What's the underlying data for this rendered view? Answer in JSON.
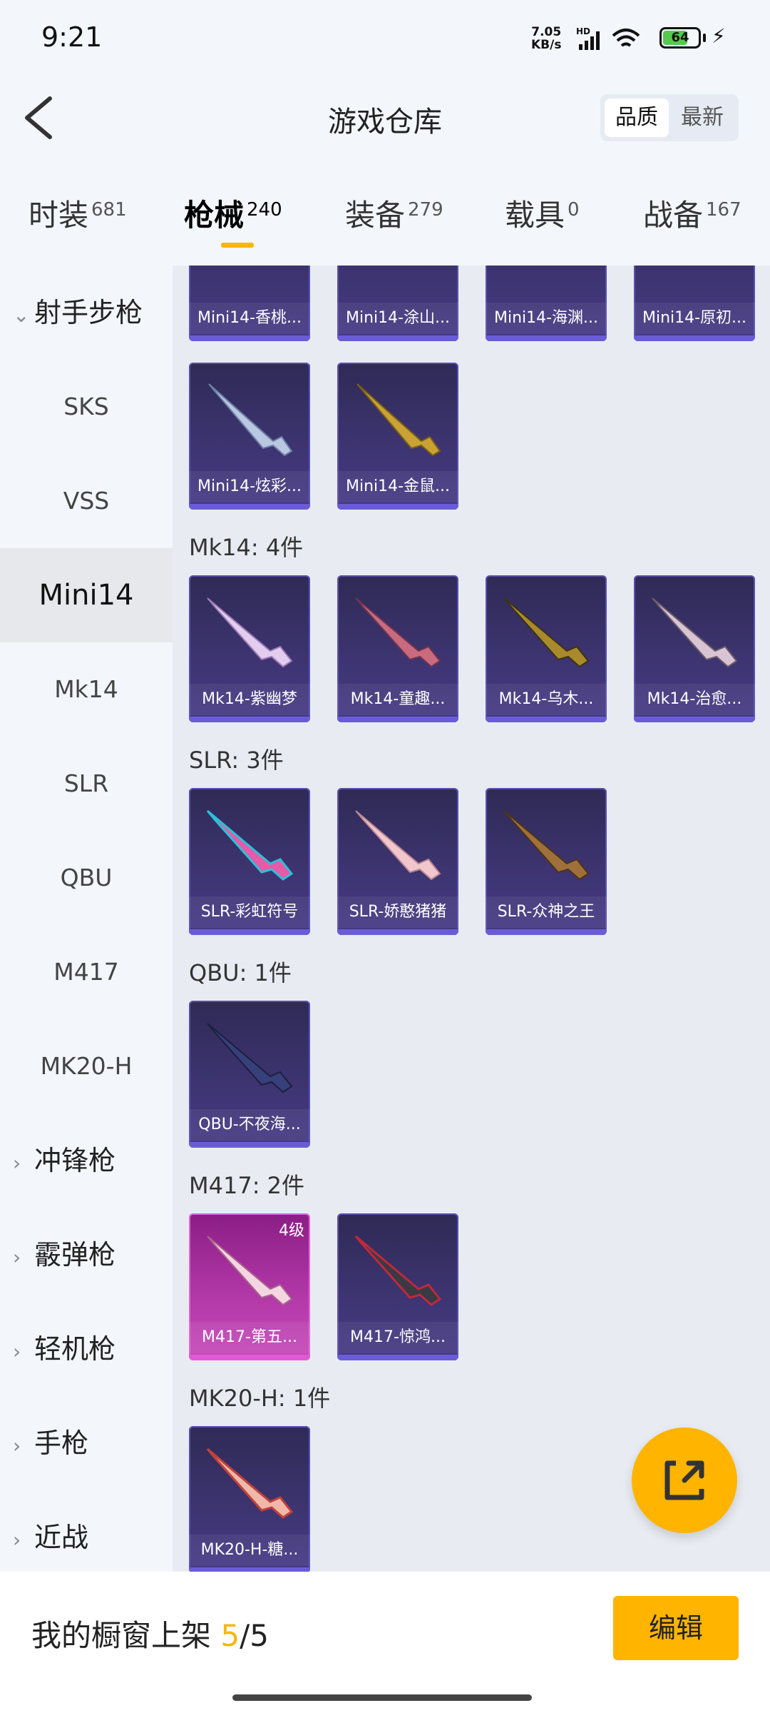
{
  "status_bar": {
    "time": "9:21",
    "net_speed_value": "7.05",
    "net_speed_unit": "KB/s",
    "hd_label": "HD",
    "battery": "64"
  },
  "header": {
    "title": "游戏仓库",
    "sort_options": [
      "品质",
      "最新"
    ],
    "sort_active": "品质"
  },
  "tabs": [
    {
      "label": "时装",
      "count": "681"
    },
    {
      "label": "枪械",
      "count": "240",
      "active": true
    },
    {
      "label": "装备",
      "count": "279"
    },
    {
      "label": "载具",
      "count": "0"
    },
    {
      "label": "战备",
      "count": "167"
    }
  ],
  "sidebar": {
    "group_expanded": "射手步枪",
    "items": [
      "SKS",
      "VSS",
      "Mini14",
      "Mk14",
      "SLR",
      "QBU",
      "M417",
      "MK20-H"
    ],
    "active_item": "Mini14",
    "groups_collapsed": [
      "冲锋枪",
      "霰弹枪",
      "轻机枪",
      "手枪",
      "近战"
    ]
  },
  "content": {
    "partial_row": [
      "Mini14-香桃...",
      "Mini14-涂山...",
      "Mini14-海渊...",
      "Mini14-原初..."
    ],
    "mini14_row2": [
      "Mini14-炫彩...",
      "Mini14-金鼠..."
    ],
    "sections": [
      {
        "label": "Mk14: 4件",
        "items": [
          "Mk14-紫幽梦",
          "Mk14-童趣...",
          "Mk14-乌木...",
          "Mk14-治愈..."
        ]
      },
      {
        "label": "SLR: 3件",
        "items": [
          "SLR-彩虹符号",
          "SLR-娇憨猪猪",
          "SLR-众神之王"
        ]
      },
      {
        "label": "QBU: 1件",
        "items": [
          "QBU-不夜海..."
        ]
      },
      {
        "label": "M417: 2件",
        "items": [
          "M417-第五...",
          "M417-惊鸿..."
        ],
        "level_badge": "4级"
      },
      {
        "label": "MK20-H: 1件",
        "items": [
          "MK20-H-糖..."
        ]
      }
    ]
  },
  "bottom_bar": {
    "label": "我的橱窗上架",
    "count_current": "5",
    "count_sep": "/",
    "count_total": "5",
    "edit_label": "编辑"
  },
  "colors": {
    "accent": "#ffb400",
    "card_purple": "#3d3470",
    "card_pink": "#b43aa9"
  }
}
